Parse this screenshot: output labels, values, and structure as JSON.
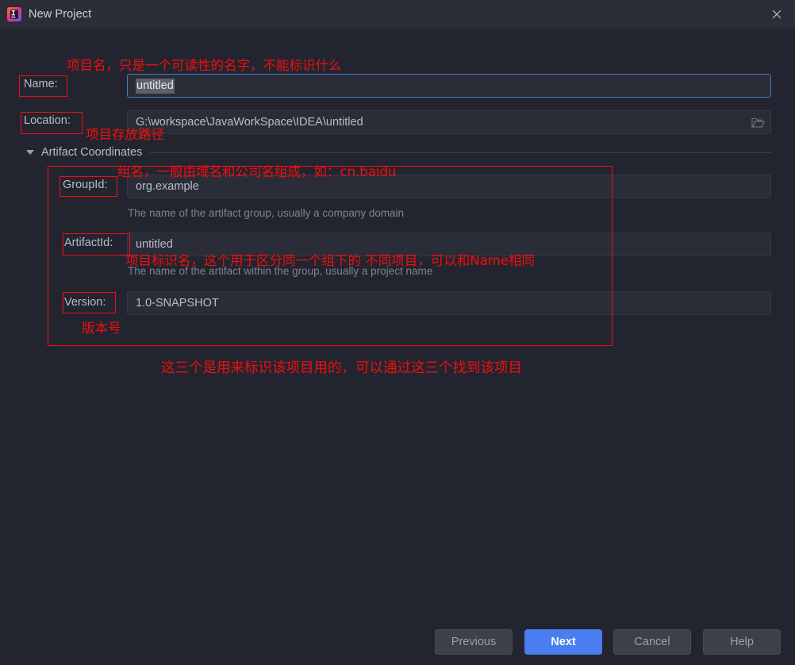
{
  "window": {
    "title": "New Project",
    "app_icon": "intellij-idea-icon",
    "close_icon": "close-icon"
  },
  "form": {
    "name": {
      "label": "Name:",
      "value": "untitled",
      "selected": true
    },
    "location": {
      "label": "Location:",
      "value": "G:\\workspace\\JavaWorkSpace\\IDEA\\untitled",
      "browse_icon": "folder-open-icon"
    },
    "artifact_section": {
      "title": "Artifact Coordinates",
      "expanded": true,
      "collapse_icon": "triangle-down-icon",
      "group_id": {
        "label": "GroupId:",
        "value": "org.example",
        "hint": "The name of the artifact group, usually a company domain"
      },
      "artifact_id": {
        "label": "ArtifactId:",
        "value": "untitled",
        "hint": "The name of the artifact within the group, usually a project name"
      },
      "version": {
        "label": "Version:",
        "value": "1.0-SNAPSHOT"
      }
    }
  },
  "annotations": {
    "color": "#f40d0d",
    "name_note": "项目名，只是一个可读性的名字，不能标识什么",
    "location_note": "项目存放路径",
    "group_note": "组名，一般由域名和公司名组成，如：cn.baidu",
    "artifact_note": "项目标识名，这个用于区分同一个组下的 不同项目，可以和Name相同",
    "version_note": "版本号",
    "summary_note": "这三个是用来标识该项目用的，可以通过这三个找到该项目"
  },
  "footer": {
    "previous": "Previous",
    "next": "Next",
    "cancel": "Cancel",
    "help": "Help"
  }
}
